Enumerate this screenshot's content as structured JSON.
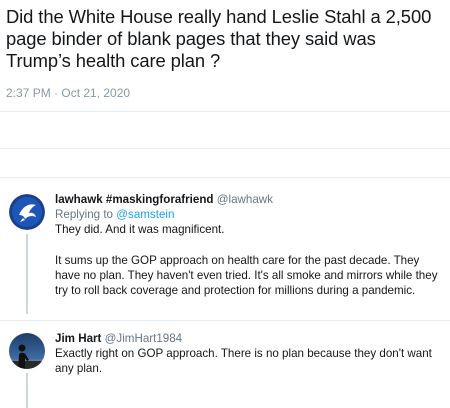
{
  "main_tweet": {
    "text": "Did the White House really hand Leslie Stahl a 2,500 page binder of blank pages that they said was Trump’s health care plan ?",
    "timestamp": "2:37 PM · Oct 21, 2020"
  },
  "replies": [
    {
      "display_name": "lawhawk #maskingforafriend",
      "handle": "@lawhawk",
      "replying_prefix": "Replying to",
      "replying_to": "@samstein",
      "paragraphs": [
        "They did. And it was magnificent.",
        "It sums up the GOP approach on health care for the past decade. They have no plan. They haven't even tried. It's all smoke and mirrors while they try to roll back coverage and protection for millions during a pandemic."
      ]
    },
    {
      "display_name": "Jim Hart",
      "handle": "@JimHart1984",
      "paragraphs": [
        "Exactly right on GOP approach. There is no plan because they don't want any plan."
      ]
    }
  ],
  "colors": {
    "text": "#14171a",
    "secondary": "#657786",
    "timestamp": "#8899a6",
    "link": "#1da1f2",
    "divider": "#e6ecf0"
  },
  "icons": {
    "reply_1_avatar": "bird-logo-avatar",
    "reply_2_avatar": "silhouette-photo-avatar"
  }
}
